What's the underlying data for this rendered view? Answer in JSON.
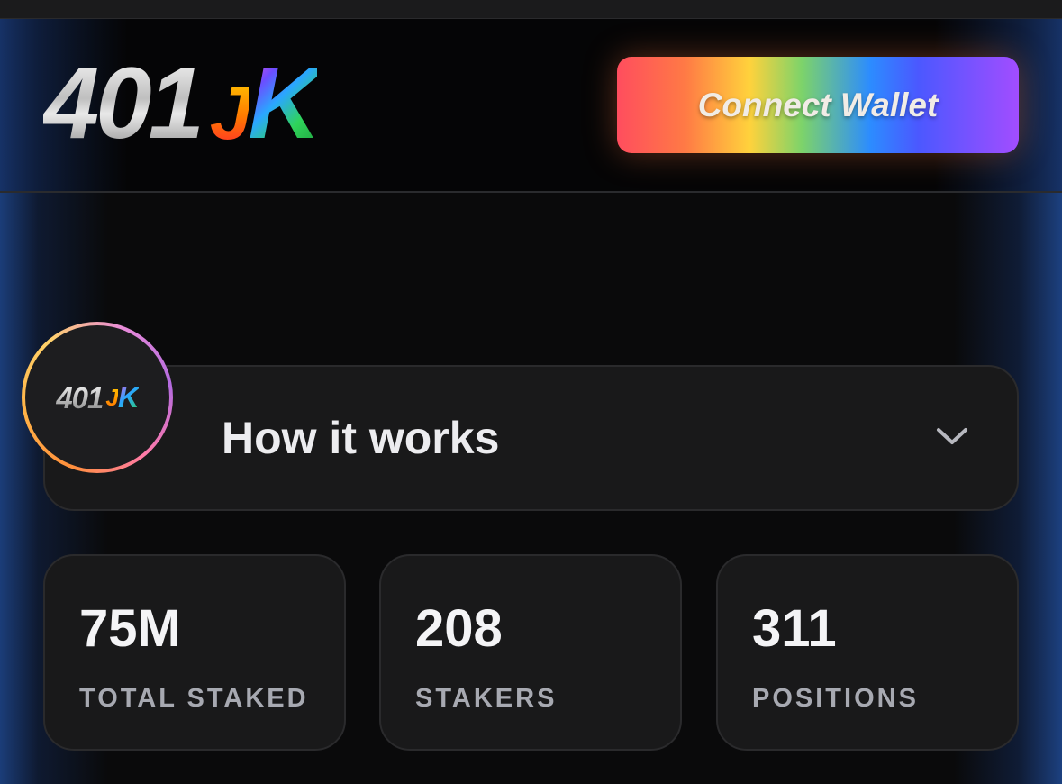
{
  "header": {
    "logo": {
      "number": "401",
      "j": "J",
      "k": "K"
    },
    "connect_label": "Connect Wallet",
    "connect_gradient": [
      "#ff4d5e",
      "#ff7a45",
      "#ffd23c",
      "#7dd36a",
      "#2c8cff",
      "#4b58ff",
      "#a24dff"
    ]
  },
  "how_it_works": {
    "title": "How it works",
    "expanded": false,
    "avatar_logo": {
      "number": "401",
      "j": "J",
      "k": "K"
    }
  },
  "stats": [
    {
      "value": "75M",
      "label": "TOTAL STAKED"
    },
    {
      "value": "208",
      "label": "STAKERS"
    },
    {
      "value": "311",
      "label": "POSITIONS"
    }
  ],
  "colors": {
    "background": "#0a0a0b",
    "card": "#19191a",
    "side_glow": "#1e468c"
  }
}
